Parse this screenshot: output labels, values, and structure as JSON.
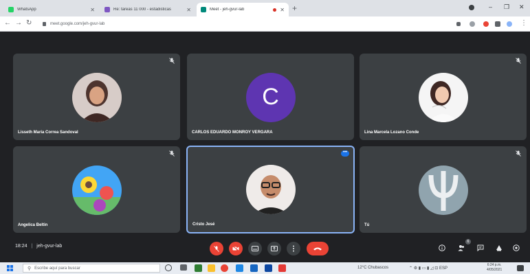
{
  "browser": {
    "tabs": [
      {
        "title": "WhatsApp",
        "favicon_color": "#25d366"
      },
      {
        "title": "Re: tareas 11 000 - estadisticas",
        "favicon_color": "#7e57c2"
      },
      {
        "title": "Meet - jeh-gvur-lab",
        "favicon_color": "#00897b"
      }
    ],
    "new_tab_label": "+",
    "address": "meet.google.com/jeh-gvur-lab"
  },
  "meet": {
    "participants": [
      {
        "name": "Lisseth Maria Correa Sandoval",
        "avatar": "photo",
        "avatar_color": "#8d6e63",
        "mic": "muted"
      },
      {
        "name": "CARLOS EDUARDO MONROY VERGARA",
        "avatar": "letter",
        "avatar_letter": "C",
        "avatar_color": "#5e35b1",
        "mic": "muted"
      },
      {
        "name": "Lina Marcela Lozano Conde",
        "avatar": "photo",
        "avatar_color": "#e0e0e0",
        "mic": "muted"
      },
      {
        "name": "Angelica Beltin",
        "avatar": "photo",
        "avatar_color": "#42a5f5",
        "mic": "muted"
      },
      {
        "name": "Cristo Jesé",
        "avatar": "photo",
        "avatar_color": "#efebe9",
        "mic": "active"
      },
      {
        "name": "Tú",
        "avatar": "photo",
        "avatar_color": "#90a4ae",
        "mic": "muted"
      }
    ],
    "time": "18:24",
    "meeting_code": "jeh-gvur-lab",
    "participant_count": "6",
    "accent": "#8ab4f8",
    "danger": "#ea4335"
  },
  "taskbar": {
    "search_placeholder": "Escribe aquí para buscar",
    "weather": "12°C Chubascos",
    "clock_time": "6:24 p.m.",
    "clock_date": "4/05/2021"
  }
}
